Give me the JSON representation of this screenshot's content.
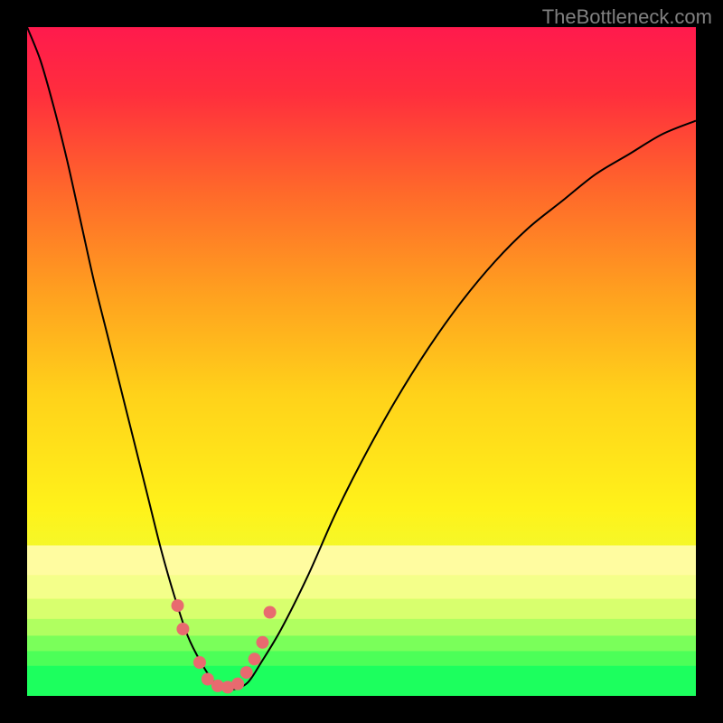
{
  "watermark": "TheBottleneck.com",
  "chart_data": {
    "type": "line",
    "title": "",
    "xlabel": "",
    "ylabel": "",
    "xlim": [
      0,
      100
    ],
    "ylim": [
      0,
      100
    ],
    "background_gradient": {
      "stops": [
        {
          "offset": 0.0,
          "color": "#ff1a4d"
        },
        {
          "offset": 0.1,
          "color": "#ff2e3d"
        },
        {
          "offset": 0.25,
          "color": "#ff6a2a"
        },
        {
          "offset": 0.4,
          "color": "#ffa11f"
        },
        {
          "offset": 0.55,
          "color": "#ffd21a"
        },
        {
          "offset": 0.72,
          "color": "#fff21a"
        },
        {
          "offset": 0.85,
          "color": "#e8ff3a"
        },
        {
          "offset": 0.92,
          "color": "#a0ff6a"
        },
        {
          "offset": 1.0,
          "color": "#1aff66"
        }
      ]
    },
    "bottom_bands": [
      {
        "y": 77.5,
        "height": 4.5,
        "color": "#fffca0"
      },
      {
        "y": 82.0,
        "height": 3.5,
        "color": "#f4ff8a"
      },
      {
        "y": 85.5,
        "height": 3.0,
        "color": "#d8ff6e"
      },
      {
        "y": 88.5,
        "height": 2.5,
        "color": "#b0ff60"
      },
      {
        "y": 91.0,
        "height": 2.3,
        "color": "#7aff5a"
      },
      {
        "y": 93.3,
        "height": 2.2,
        "color": "#4cff58"
      },
      {
        "y": 95.5,
        "height": 4.5,
        "color": "#1cff5e"
      }
    ],
    "curve": {
      "x": [
        0,
        2,
        4,
        6,
        8,
        10,
        12,
        14,
        16,
        18,
        20,
        22,
        24,
        26,
        28,
        29.5,
        31,
        33,
        35,
        38,
        42,
        46,
        50,
        55,
        60,
        65,
        70,
        75,
        80,
        85,
        90,
        95,
        100
      ],
      "y": [
        100,
        95,
        88,
        80,
        71,
        62,
        54,
        46,
        38,
        30,
        22,
        15,
        9,
        5,
        2,
        1,
        1,
        2,
        5,
        10,
        18,
        27,
        35,
        44,
        52,
        59,
        65,
        70,
        74,
        78,
        81,
        84,
        86
      ]
    },
    "markers": [
      {
        "x": 22.5,
        "y": 13.5
      },
      {
        "x": 23.3,
        "y": 10.0
      },
      {
        "x": 25.8,
        "y": 5.0
      },
      {
        "x": 27.0,
        "y": 2.5
      },
      {
        "x": 28.5,
        "y": 1.5
      },
      {
        "x": 30.0,
        "y": 1.3
      },
      {
        "x": 31.5,
        "y": 1.8
      },
      {
        "x": 32.8,
        "y": 3.5
      },
      {
        "x": 34.0,
        "y": 5.5
      },
      {
        "x": 35.2,
        "y": 8.0
      },
      {
        "x": 36.3,
        "y": 12.5
      }
    ],
    "marker_style": {
      "color": "#e86a6f",
      "radius_px": 7
    }
  }
}
